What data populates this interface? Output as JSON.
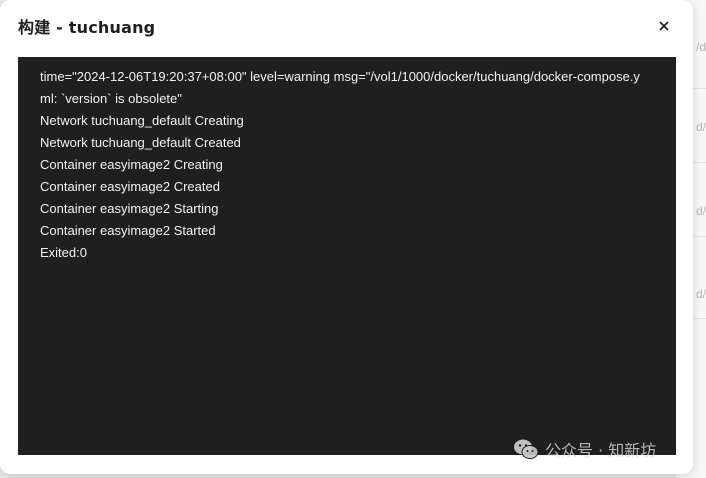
{
  "dialog": {
    "title": "构建 - tuchuang",
    "close_icon": "close-icon"
  },
  "terminal": {
    "lines": [
      "time=\"2024-12-06T19:20:37+08:00\" level=warning msg=\"/vol1/1000/docker/tuchuang/docker-compose.y",
      "ml: `version` is obsolete\"",
      "Network tuchuang_default Creating",
      "Network tuchuang_default Created",
      "Container easyimage2 Creating",
      "Container easyimage2 Created",
      "Container easyimage2 Starting",
      "Container easyimage2 Started",
      "Exited:0"
    ]
  },
  "watermark": {
    "icon": "wechat-icon",
    "text": "公众号 · 知新坊"
  },
  "background": {
    "fragments": [
      "/d",
      "d/",
      "d/",
      "d/"
    ]
  }
}
